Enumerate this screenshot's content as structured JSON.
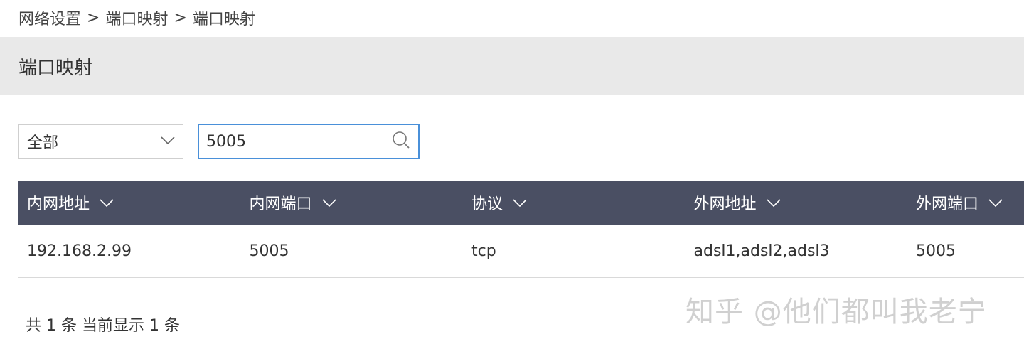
{
  "breadcrumb": {
    "items": [
      "网络设置",
      "端口映射",
      "端口映射"
    ],
    "separator": ">"
  },
  "header": {
    "title": "端口映射"
  },
  "filter": {
    "selected": "全部"
  },
  "search": {
    "value": "5005"
  },
  "table": {
    "columns": [
      "内网地址",
      "内网端口",
      "协议",
      "外网地址",
      "外网端口"
    ],
    "rows": [
      [
        "192.168.2.99",
        "5005",
        "tcp",
        "adsl1,adsl2,adsl3",
        "5005"
      ]
    ]
  },
  "footer": {
    "summary": "共 1 条 当前显示 1 条"
  },
  "watermark": {
    "text": "知乎 @他们都叫我老宁"
  },
  "colors": {
    "header_bg": "#e9e9e9",
    "table_header_bg": "#4a4f63",
    "search_border": "#4a90d9"
  },
  "icons": {
    "dropdown": "chevron-down-icon",
    "search": "search-icon",
    "sort": "chevron-down-icon"
  }
}
